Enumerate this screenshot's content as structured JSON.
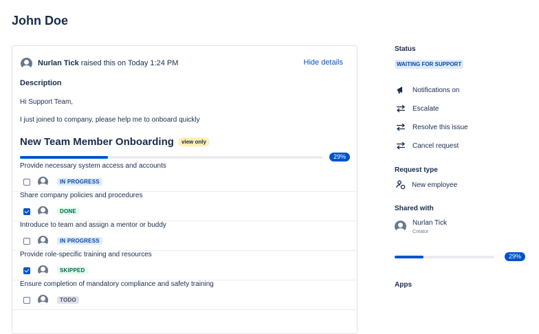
{
  "page": {
    "title": "John Doe"
  },
  "request": {
    "reporter": "Nurlan Tick",
    "raised_text": "raised this on Today 1:24 PM",
    "hide_details_label": "Hide details",
    "description_label": "Description",
    "description_lines": [
      "Hi Support Team,",
      "I just joined to company, please help me to onboard quickly"
    ]
  },
  "checklist": {
    "title": "New Team Member Onboarding",
    "badge": "view only",
    "progress_percent": 29,
    "progress_label": "29%",
    "items": [
      {
        "title": "Provide necessary system access and accounts",
        "checked": false,
        "status": "IN PROGRESS"
      },
      {
        "title": "Share company policies and procedures",
        "checked": true,
        "status": "DONE"
      },
      {
        "title": "Introduce to team and assign a mentor or buddy",
        "checked": false,
        "status": "IN PROGRESS"
      },
      {
        "title": "Provide role-specific training and resources",
        "checked": true,
        "status": "SKIPPED"
      },
      {
        "title": "Ensure completion of mandatory compliance and safety training",
        "checked": false,
        "status": "TODO"
      }
    ]
  },
  "sidebar": {
    "status_label": "Status",
    "status_value": "WAITING FOR SUPPORT",
    "actions": [
      {
        "label": "Notifications on",
        "icon": "megaphone-icon"
      },
      {
        "label": "Escalate",
        "icon": "transition-icon"
      },
      {
        "label": "Resolve this issue",
        "icon": "transition-icon"
      },
      {
        "label": "Cancel request",
        "icon": "transition-icon"
      }
    ],
    "request_type_label": "Request type",
    "request_type_value": "New employee",
    "shared_with_label": "Shared with",
    "shared_name": "Nurlan Tick",
    "shared_role": "Creator",
    "progress_percent": 29,
    "progress_label": "29%",
    "apps_label": "Apps"
  },
  "colors": {
    "accent": "#0052cc",
    "text": "#172b4d",
    "border": "#dfe1e6"
  }
}
